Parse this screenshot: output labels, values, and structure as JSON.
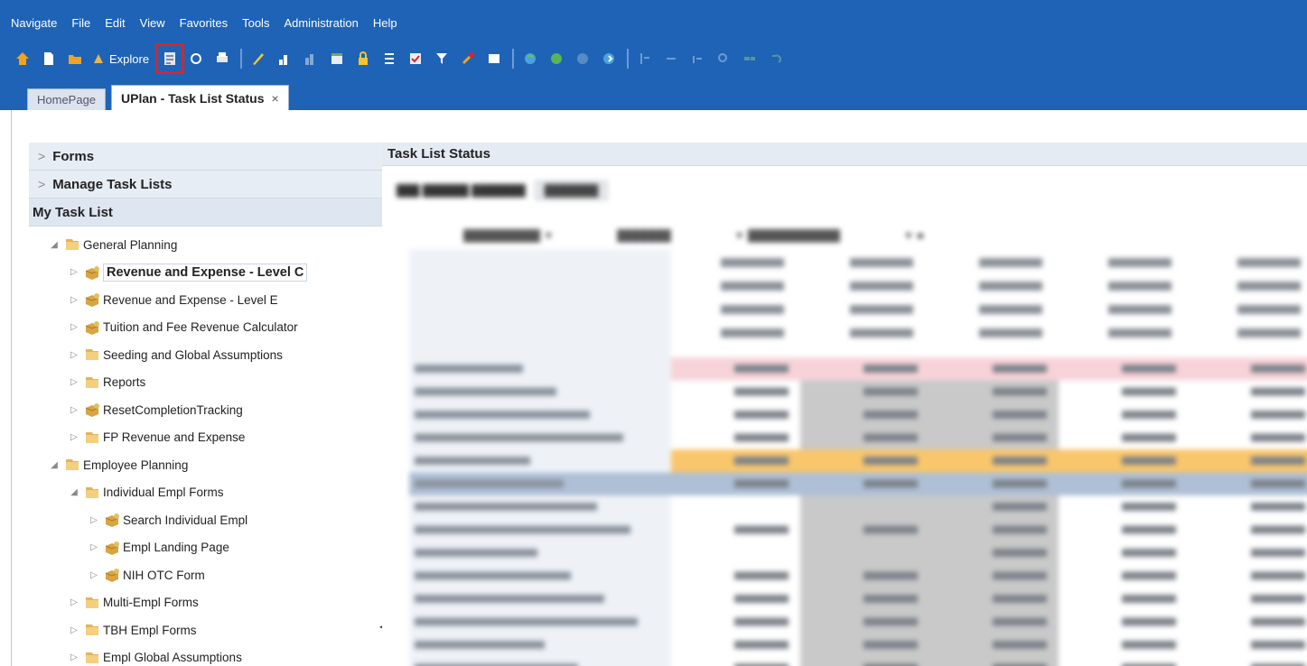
{
  "menubar": {
    "items": [
      "Navigate",
      "File",
      "Edit",
      "View",
      "Favorites",
      "Tools",
      "Administration",
      "Help"
    ]
  },
  "toolbar": {
    "explore_label": "Explore"
  },
  "tabs": {
    "home": "HomePage",
    "active": "UPlan - Task List Status",
    "close": "×"
  },
  "leftnav": {
    "forms": "Forms",
    "manage_task_lists": "Manage Task Lists",
    "my_task_list": "My Task List",
    "tree": [
      {
        "label": "General Planning",
        "level": 0,
        "icon": "folder-icon",
        "toggle": "◢"
      },
      {
        "label": "Revenue and Expense - Level C",
        "level": 1,
        "icon": "task-icon",
        "toggle": "▷",
        "selected": true
      },
      {
        "label": "Revenue and Expense - Level E",
        "level": 1,
        "icon": "task-icon",
        "toggle": "▷"
      },
      {
        "label": "Tuition and Fee Revenue Calculator",
        "level": 1,
        "icon": "task-icon",
        "toggle": "▷"
      },
      {
        "label": "Seeding and Global Assumptions",
        "level": 1,
        "icon": "folder-icon",
        "toggle": "▷"
      },
      {
        "label": "Reports",
        "level": 1,
        "icon": "folder-icon",
        "toggle": "▷"
      },
      {
        "label": "ResetCompletionTracking",
        "level": 1,
        "icon": "task-icon",
        "toggle": "▷"
      },
      {
        "label": "FP Revenue and Expense",
        "level": 1,
        "icon": "folder-icon",
        "toggle": "▷"
      },
      {
        "label": "Employee Planning",
        "level": 0,
        "icon": "folder-icon",
        "toggle": "◢"
      },
      {
        "label": "Individual Empl Forms",
        "level": 1,
        "icon": "folder-icon",
        "toggle": "◢"
      },
      {
        "label": "Search Individual Empl",
        "level": 2,
        "icon": "task-icon",
        "toggle": "▷"
      },
      {
        "label": "Empl Landing Page",
        "level": 2,
        "icon": "task-icon",
        "toggle": "▷"
      },
      {
        "label": "NIH OTC Form",
        "level": 2,
        "icon": "task-icon",
        "toggle": "▷"
      },
      {
        "label": "Multi-Empl Forms",
        "level": 1,
        "icon": "folder-icon",
        "toggle": "▷"
      },
      {
        "label": "TBH Empl Forms",
        "level": 1,
        "icon": "folder-icon",
        "toggle": "▷"
      },
      {
        "label": "Empl Global Assumptions",
        "level": 1,
        "icon": "folder-icon",
        "toggle": "▷"
      }
    ]
  },
  "rightpanel": {
    "title": "Task List Status"
  },
  "colors": {
    "band": "#1e63b5",
    "highlight": "#d6262c",
    "pink": "#f7d3d9",
    "orange": "#f9c66b",
    "blue_row": "#aebfd6",
    "gray_col": "#c9c9c9"
  }
}
